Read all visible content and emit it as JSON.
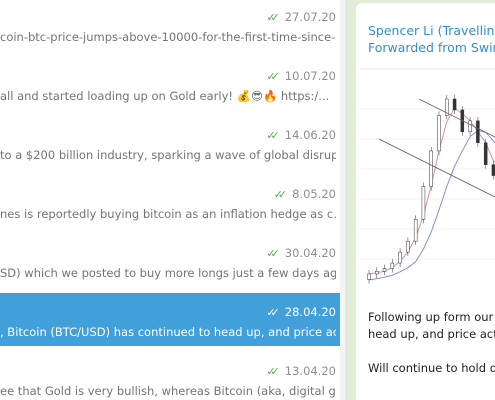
{
  "chats": [
    {
      "date": "27.07.20",
      "preview": "coin-btc-price-jumps-above-10000-for-the-first-time-since-...",
      "selected": false
    },
    {
      "date": "10.07.20",
      "preview": "all and started loading up on Gold early! 💰😎🔥  https:/...",
      "selected": false
    },
    {
      "date": "14.06.20",
      "preview": "to a $200 billion industry, sparking a wave of global disrupt...",
      "selected": false
    },
    {
      "date": "8.05.20",
      "preview": "nes is reportedly buying bitcoin as an inflation hedge as c...",
      "selected": false
    },
    {
      "date": "30.04.20",
      "preview": "SD) which we posted to buy more longs just a few days ag...",
      "selected": false
    },
    {
      "date": "28.04.20",
      "preview": ", Bitcoin (BTC/USD) has continued to head up, and price ac...",
      "selected": true
    },
    {
      "date": "13.04.20",
      "preview": "ee that Gold is very bullish, whereas Bitcoin (aka, digital gol...",
      "selected": false
    }
  ],
  "message": {
    "sender": "Spencer Li (Travelling",
    "forwarded": "Forwarded from Swir",
    "caption_lines": [
      "Following up form our",
      "head up, and price acti",
      "Will continue to hold o"
    ]
  },
  "chart_data": {
    "type": "line",
    "title": "",
    "series": [
      {
        "values": [
          10,
          11,
          12,
          14,
          18,
          22,
          30,
          42,
          55,
          68,
          74,
          70,
          62,
          66,
          58,
          50,
          46,
          52,
          60
        ]
      }
    ]
  }
}
